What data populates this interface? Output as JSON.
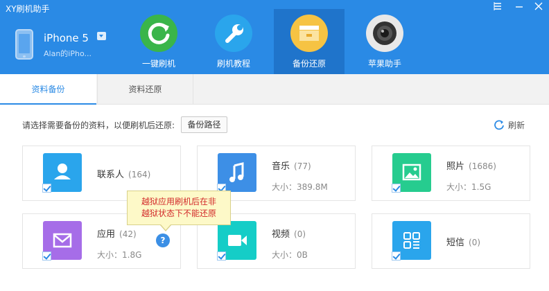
{
  "titlebar": {
    "title": "XY刷机助手"
  },
  "device": {
    "name": "iPhone 5",
    "owner": "Alan的iPho..."
  },
  "nav": [
    {
      "label": "一键刷机",
      "icon": "refresh-circle-icon",
      "color": "#3ab54a"
    },
    {
      "label": "刷机教程",
      "icon": "wrench-icon",
      "color": "#2aa5ec"
    },
    {
      "label": "备份还原",
      "icon": "folder-icon",
      "color": "#f6c343"
    },
    {
      "label": "苹果助手",
      "icon": "camera-lens-icon",
      "color": "#e8e8e8"
    }
  ],
  "tabs": [
    {
      "label": "资料备份",
      "active": true
    },
    {
      "label": "资料还原",
      "active": false
    }
  ],
  "toolbar": {
    "instruction": "请选择需要备份的资料，以便刷机后还原:",
    "path_button": "备份路径",
    "refresh_label": "刷新"
  },
  "cards": [
    {
      "title": "联系人",
      "count": "(164)",
      "size": "",
      "icon": "contact-icon",
      "color": "#2aa5ec"
    },
    {
      "title": "音乐",
      "count": "(77)",
      "size": "大小：389.8M",
      "icon": "music-note-icon",
      "color": "#3d8fe6"
    },
    {
      "title": "照片",
      "count": "(1686)",
      "size": "大小：1.5G",
      "icon": "image-icon",
      "color": "#26cc8f"
    },
    {
      "title": "应用",
      "count": "(42)",
      "size": "大小：1.8G",
      "icon": "envelope-icon",
      "color": "#a66de8"
    },
    {
      "title": "视频",
      "count": "(0)",
      "size": "大小：0B",
      "icon": "video-camera-icon",
      "color": "#15cdc7"
    },
    {
      "title": "短信",
      "count": "(0)",
      "size": "",
      "icon": "grid-icon",
      "color": "#2aa5ec"
    }
  ],
  "tooltip": {
    "line1": "越狱应用刷机后在非",
    "line2": "越狱状态下不能还原"
  },
  "help": {
    "icon": "?"
  }
}
